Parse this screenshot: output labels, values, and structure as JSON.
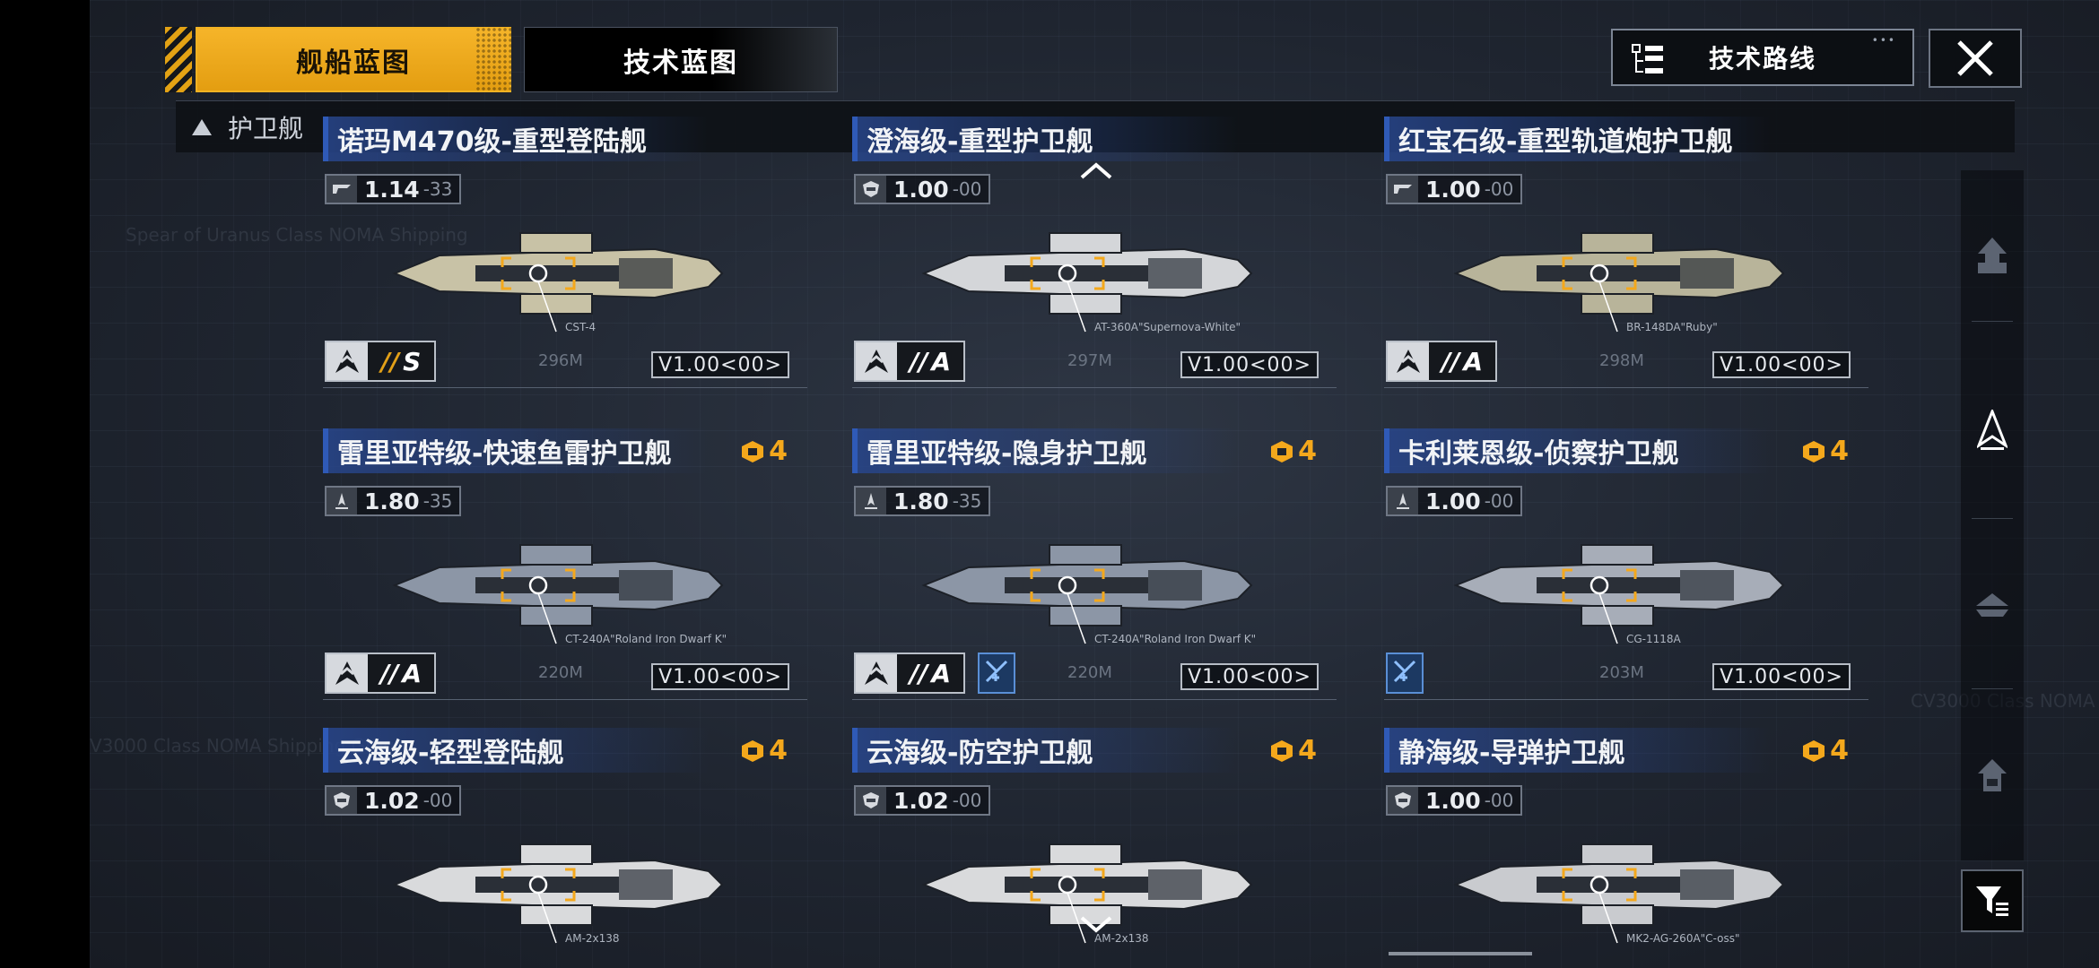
{
  "tabs": {
    "ship_blueprint": "舰船蓝图",
    "tech_blueprint": "技术蓝图"
  },
  "tech_route": {
    "label": "技术路线",
    "icon": "tree-list-icon"
  },
  "close": {
    "icon": "close-icon"
  },
  "section": {
    "title": "护卫舰",
    "icon": "collapse-triangle-icon"
  },
  "colors": {
    "accent": "#f4a81c",
    "name_bar": "#2f5ab7",
    "skill_badge": "#5a8fd6"
  },
  "ships": [
    {
      "name": "诺玛M470级-重型登陆舰",
      "cost": "",
      "stat_main": "1.14",
      "stat_sub": "-33",
      "stat_icon": "speed-icon",
      "weapon": "CST-4",
      "length": "296M",
      "rank": "S",
      "version": "V1.00<00>",
      "skill": false
    },
    {
      "name": "澄海级-重型护卫舰",
      "cost": "",
      "stat_main": "1.00",
      "stat_sub": "-00",
      "stat_icon": "shield-icon",
      "weapon": "AT-360A\"Supernova-White\"",
      "length": "297M",
      "rank": "A",
      "version": "V1.00<00>",
      "skill": false
    },
    {
      "name": "红宝石级-重型轨道炮护卫舰",
      "cost": "",
      "stat_main": "1.00",
      "stat_sub": "-00",
      "stat_icon": "speed-icon",
      "weapon": "BR-148DA\"Ruby\"",
      "length": "298M",
      "rank": "A",
      "version": "V1.00<00>",
      "skill": false
    },
    {
      "name": "雷里亚特级-快速鱼雷护卫舰",
      "cost": "4",
      "stat_main": "1.80",
      "stat_sub": "-35",
      "stat_icon": "thruster-icon",
      "weapon": "CT-240A\"Roland Iron Dwarf K\"",
      "length": "220M",
      "rank": "A",
      "version": "V1.00<00>",
      "skill": false
    },
    {
      "name": "雷里亚特级-隐身护卫舰",
      "cost": "4",
      "stat_main": "1.80",
      "stat_sub": "-35",
      "stat_icon": "thruster-icon",
      "weapon": "CT-240A\"Roland Iron Dwarf K\"",
      "length": "220M",
      "rank": "A",
      "version": "V1.00<00>",
      "skill": true
    },
    {
      "name": "卡利莱恩级-侦察护卫舰",
      "cost": "4",
      "stat_main": "1.00",
      "stat_sub": "-00",
      "stat_icon": "thruster-icon",
      "weapon": "CG-1118A",
      "length": "203M",
      "rank": "",
      "version": "V1.00<00>",
      "skill": true
    },
    {
      "name": "云海级-轻型登陆舰",
      "cost": "4",
      "stat_main": "1.02",
      "stat_sub": "-00",
      "stat_icon": "shield-icon",
      "weapon": "AM-2x138",
      "length": "",
      "rank": "",
      "version": "",
      "skill": false
    },
    {
      "name": "云海级-防空护卫舰",
      "cost": "4",
      "stat_main": "1.02",
      "stat_sub": "-00",
      "stat_icon": "shield-icon",
      "weapon": "AM-2x138",
      "length": "",
      "rank": "",
      "version": "",
      "skill": false
    },
    {
      "name": "静海级-导弹护卫舰",
      "cost": "4",
      "stat_main": "1.00",
      "stat_sub": "-00",
      "stat_icon": "shield-icon",
      "weapon": "MK2-AG-260A\"C-oss\"",
      "length": "",
      "rank": "",
      "version": "",
      "skill": false
    }
  ],
  "sidenav": {
    "items": [
      "carrier-icon",
      "frigate-icon",
      "destroyer-icon",
      "cruiser-icon"
    ],
    "active_index": 1,
    "filter_icon": "filter-icon"
  }
}
